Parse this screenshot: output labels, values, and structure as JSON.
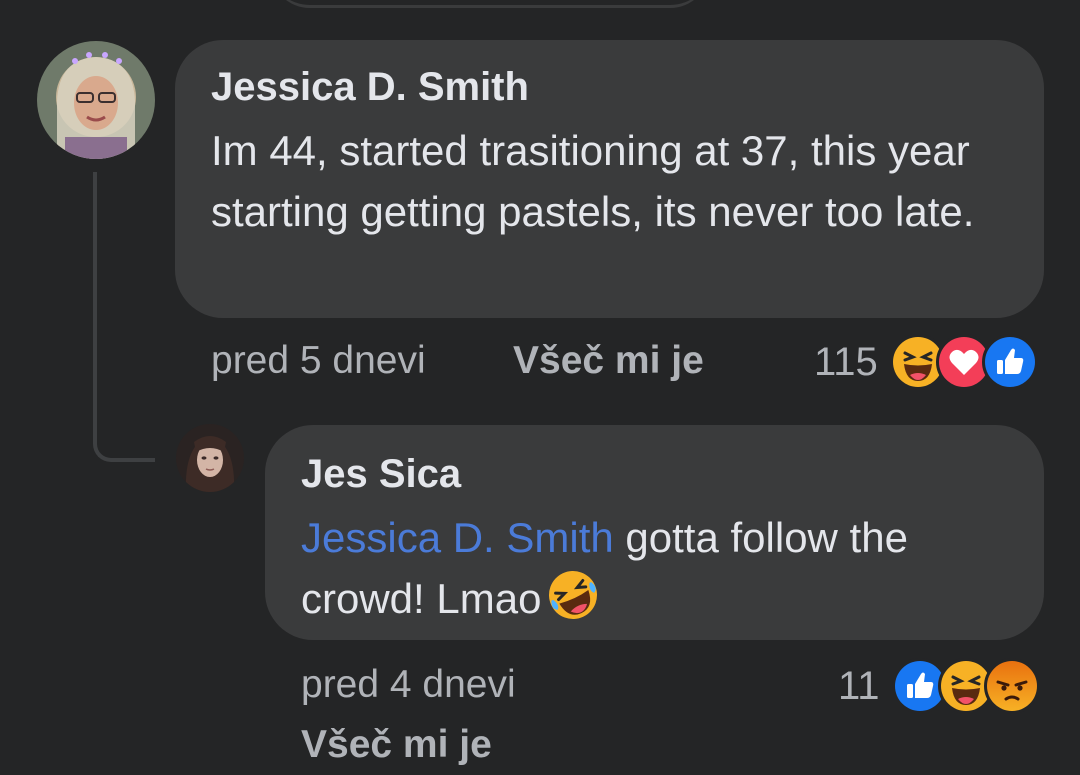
{
  "comments": [
    {
      "author": "Jessica D. Smith",
      "text": "Im 44, started trasitioning at 37, this year starting getting pastels, its never too late.",
      "time": "pred 5 dnevi",
      "like_label": "Všeč mi je",
      "reaction_count": "115",
      "reactions": [
        "haha-icon",
        "love-icon",
        "like-icon"
      ]
    },
    {
      "author": "Jes Sica",
      "mention": "Jessica D. Smith",
      "text": " gotta follow the crowd! Lmao",
      "inline_emoji": "rolling-on-floor-laughing-emoji",
      "time": "pred 4 dnevi",
      "like_label": "Všeč mi je",
      "reaction_count": "11",
      "reactions": [
        "like-icon",
        "haha-icon",
        "angry-icon"
      ]
    }
  ],
  "colors": {
    "background": "#242526",
    "bubble": "#3a3b3c",
    "text": "#e4e6eb",
    "meta_text": "#b0b3b8",
    "mention": "#4b7bd8",
    "like_blue": "#1877f2",
    "love_red": "#f33e58",
    "haha_yellow": "#f7b125",
    "angry_orange": "#e9710f"
  }
}
